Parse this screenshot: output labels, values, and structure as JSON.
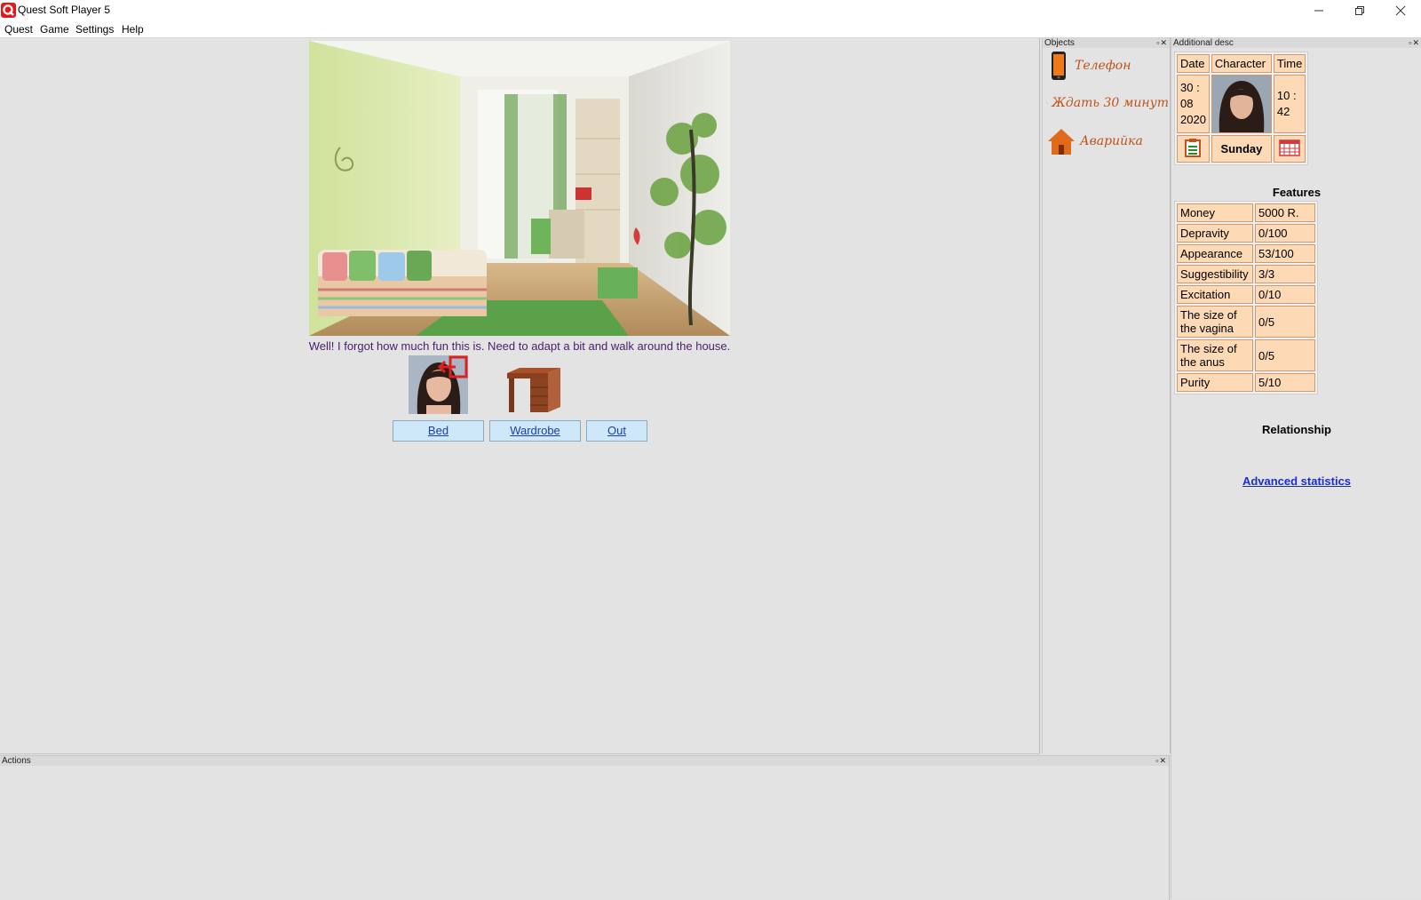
{
  "window": {
    "title": "Quest Soft Player 5"
  },
  "menu": [
    "Quest",
    "Game",
    "Settings",
    "Help"
  ],
  "panels": {
    "objects": "Objects",
    "additional": "Additional desc",
    "actions": "Actions"
  },
  "scene": {
    "text": "Well! I forgot how much fun this is. Need to adapt a bit and walk around the house.",
    "buttons": [
      "Bed",
      "Wardrobe",
      "Out"
    ]
  },
  "objects": [
    {
      "label": "Телефон",
      "icon": "phone-icon"
    },
    {
      "label": "Ждать 30 минут",
      "icon": "clock-icon"
    },
    {
      "label": "Аварийка",
      "icon": "house-icon"
    }
  ],
  "datetime": {
    "headers": [
      "Date",
      "Character",
      "Time"
    ],
    "date": [
      "30 :",
      "08",
      "2020"
    ],
    "time": [
      "10 :",
      "42"
    ],
    "day": "Sunday"
  },
  "features": {
    "title": "Features",
    "rows": [
      {
        "label": "Money",
        "value": "5000 R."
      },
      {
        "label": "Depravity",
        "value": "0/100"
      },
      {
        "label": "Appearance",
        "value": "53/100"
      },
      {
        "label": "Suggestibility",
        "value": "3/3"
      },
      {
        "label": "Excitation",
        "value": "0/10"
      },
      {
        "label": "The size of the vagina",
        "value": "0/5"
      },
      {
        "label": "The size of the anus",
        "value": "0/5"
      },
      {
        "label": "Purity",
        "value": "5/10"
      }
    ]
  },
  "relationship": {
    "title": "Relationship"
  },
  "advanced_link": "Advanced statistics",
  "colors": {
    "cell_bg": "#fdd9b5",
    "link": "#1a2fd0",
    "scene_text": "#4b1d6a",
    "object_label": "#c0521b"
  }
}
